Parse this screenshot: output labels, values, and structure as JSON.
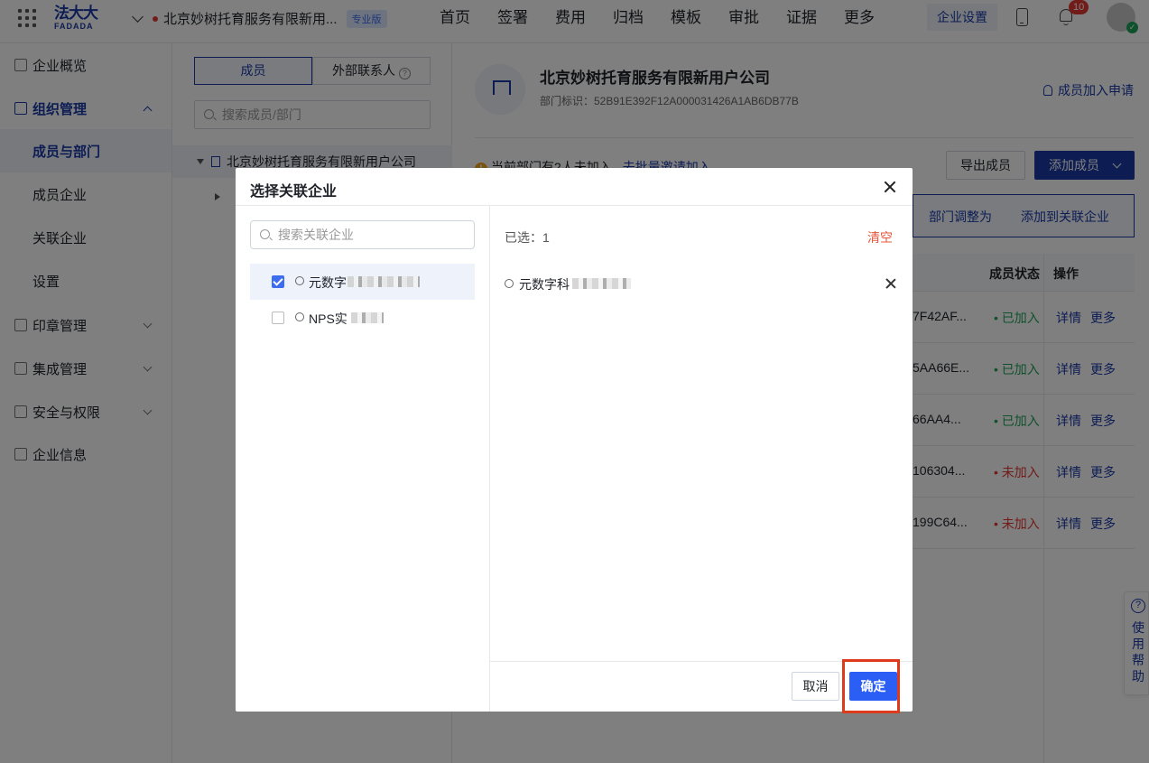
{
  "topbar": {
    "logo_line1": "法大大",
    "logo_line2": "FADADA",
    "company_name": "北京妙树托育服务有限新用...",
    "edition_badge": "专业版",
    "nav": [
      "首页",
      "签署",
      "费用",
      "归档",
      "模板",
      "审批",
      "证据",
      "更多"
    ],
    "settings_label": "企业设置",
    "notification_count": "10"
  },
  "sidebar": {
    "items": [
      {
        "label": "企业概览"
      },
      {
        "label": "组织管理"
      },
      {
        "label": "成员与部门"
      },
      {
        "label": "成员企业"
      },
      {
        "label": "关联企业"
      },
      {
        "label": "设置"
      },
      {
        "label": "印章管理"
      },
      {
        "label": "集成管理"
      },
      {
        "label": "安全与权限"
      },
      {
        "label": "企业信息"
      }
    ]
  },
  "midpanel": {
    "tab_members": "成员",
    "tab_external": "外部联系人",
    "search_placeholder": "搜索成员/部门",
    "tree_root": "北京妙树托育服务有限新用户公司"
  },
  "main": {
    "org_title": "北京妙树托育服务有限新用户公司",
    "org_id": "部门标识：52B91E392F12A000031426A1AB6DB77B",
    "join_apply": "成员加入申请",
    "warning_text": "当前部门有2人未加入",
    "warning_link": "去批量邀请加入",
    "export_label": "导出成员",
    "add_label": "添加成员",
    "bulk_adjust": "部门调整为",
    "bulk_add_related": "添加到关联企业",
    "col_status": "成员状态",
    "col_action": "操作",
    "rows": [
      {
        "hash": "7F42AF...",
        "status": "已加入",
        "a1": "详情",
        "a2": "更多"
      },
      {
        "hash": "5AA66E...",
        "status": "已加入",
        "a1": "详情",
        "a2": "更多"
      },
      {
        "hash": "66AA4...",
        "status": "已加入",
        "a1": "详情",
        "a2": "更多"
      },
      {
        "hash": "106304...",
        "status": "未加入",
        "a1": "详情",
        "a2": "更多"
      },
      {
        "hash": "199C64...",
        "status": "未加入",
        "a1": "详情",
        "a2": "更多"
      }
    ],
    "help_label": "使用帮助"
  },
  "modal": {
    "title": "选择关联企业",
    "search_placeholder": "搜索关联企业",
    "options": [
      {
        "name": "元数字",
        "checked": true
      },
      {
        "name": "NPS实",
        "checked": false
      }
    ],
    "selected_count": "已选：1",
    "clear_label": "清空",
    "selected_items": [
      {
        "name": "元数字科"
      }
    ],
    "cancel_label": "取消",
    "ok_label": "确定"
  },
  "colors": {
    "brand": "#1a3aa8",
    "primary_button": "#2b5ef5",
    "highlight_box": "#e03a1c",
    "joined": "#21a35a",
    "not_joined": "#e53935"
  }
}
